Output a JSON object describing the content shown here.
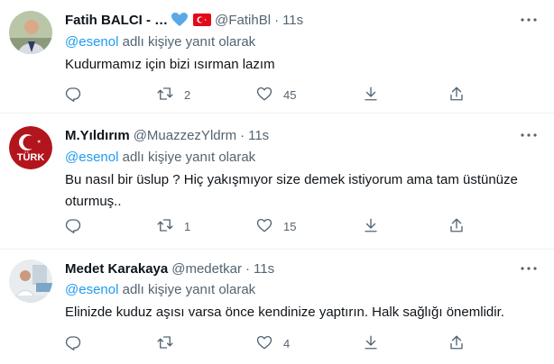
{
  "tweets": [
    {
      "name": "Fatih BALCI - …",
      "badges": {
        "heart_color": "#5aa9e6",
        "flag": "turkey-flag"
      },
      "handle": "@FatihBl",
      "dot": "·",
      "time": "11s",
      "mention": "@esenol",
      "reply_suffix": " adlı kişiye yanıt olarak",
      "text": "Kudurmamız için bizi ısırman lazım",
      "reply_count": "",
      "retweet_count": "2",
      "like_count": "45",
      "download_count": "",
      "avatar": "man-portrait-avatar"
    },
    {
      "name": "M.Yıldırım",
      "handle": "@MuazzezYldrm",
      "dot": "·",
      "time": "11s",
      "mention": "@esenol",
      "reply_suffix": " adlı kişiye yanıt olarak",
      "text": "Bu nasıl bir üslup ? Hiç yakışmıyor size demek istiyorum ama tam üstünüze oturmuş..",
      "reply_count": "",
      "retweet_count": "1",
      "like_count": "15",
      "download_count": "",
      "avatar": "turk-crescent-logo-avatar",
      "avatar_text": "TÜRK"
    },
    {
      "name": "Medet Karakaya",
      "handle": "@medetkar",
      "dot": "·",
      "time": "11s",
      "mention": "@esenol",
      "reply_suffix": " adlı kişiye yanıt olarak",
      "text": "Elinizde kuduz aşısı varsa önce kendinize yaptırın. Halk sağlığı önemlidir.",
      "reply_count": "",
      "retweet_count": "",
      "like_count": "4",
      "download_count": "",
      "avatar": "doctor-office-avatar"
    }
  ],
  "colors": {
    "accent": "#1d9bf0",
    "muted": "#536471",
    "text": "#0f1419",
    "divider": "#eff3f4",
    "flag_red": "#e30a17"
  }
}
